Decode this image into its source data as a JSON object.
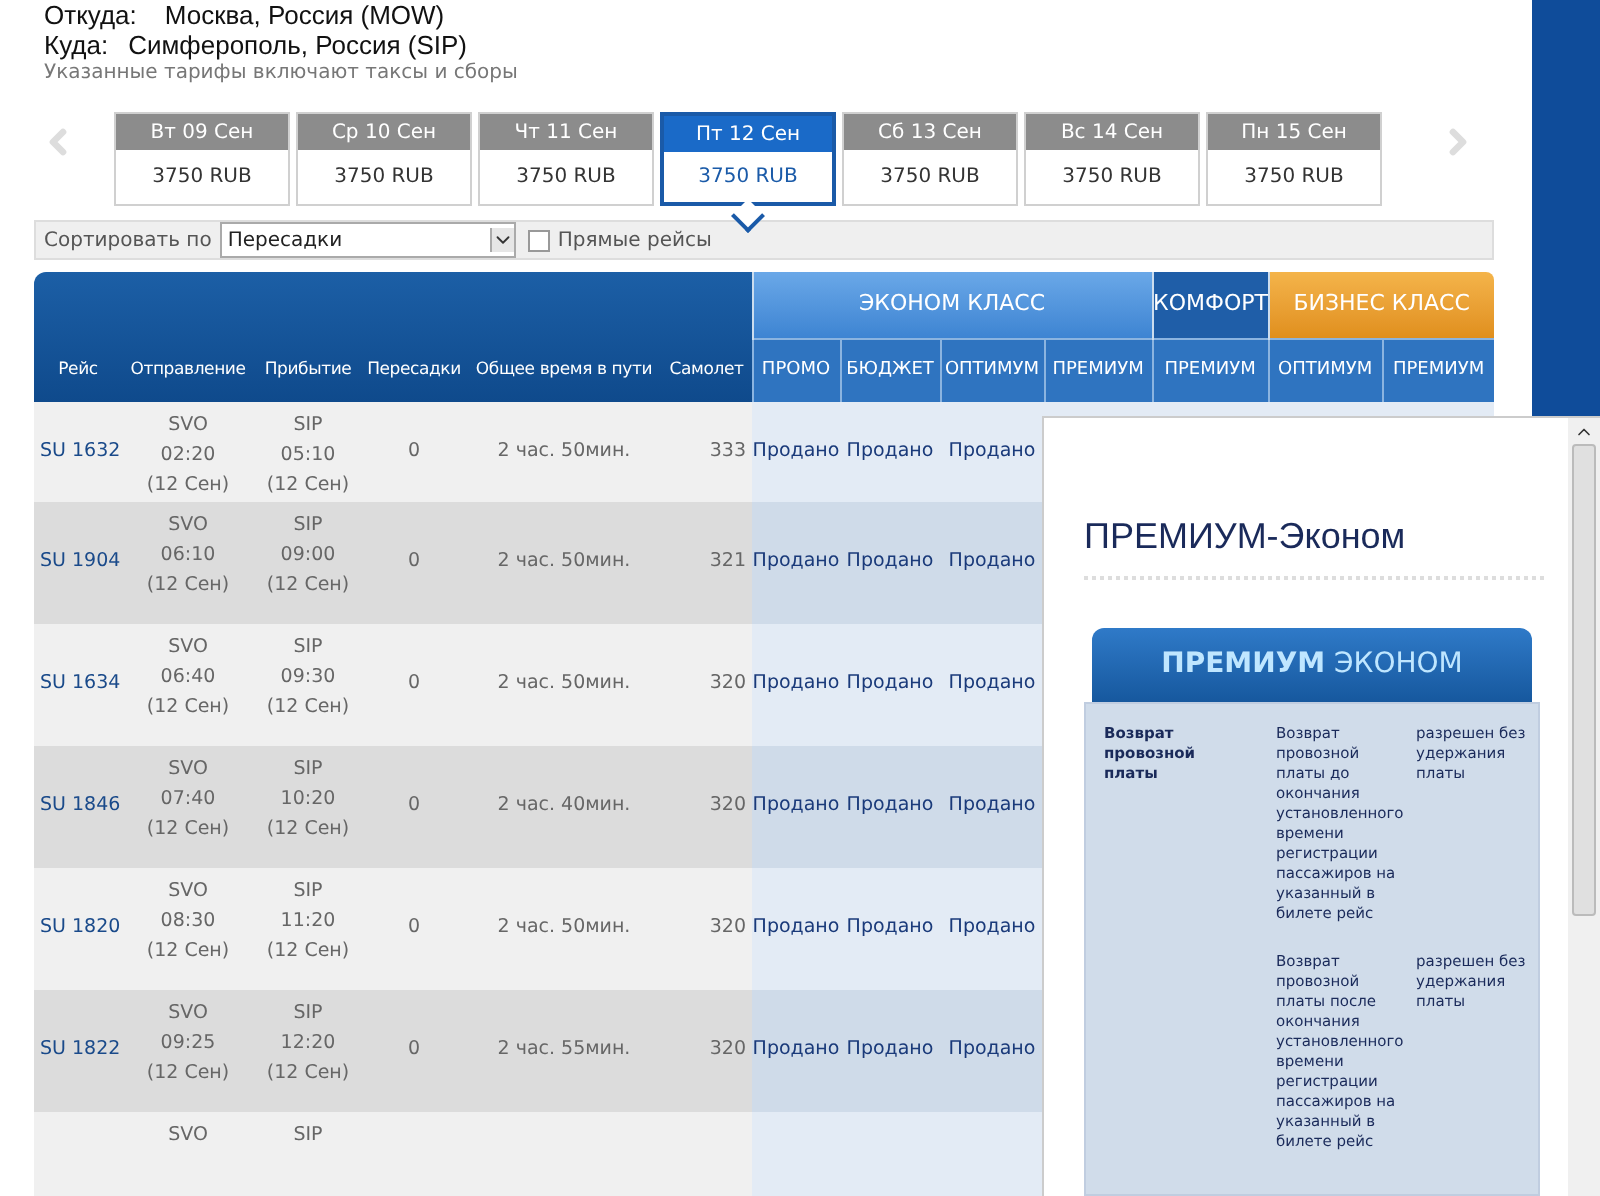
{
  "route": {
    "from_label": "Откуда:",
    "from_value": "Москва, Россия (MOW)",
    "to_label": "Куда:",
    "to_value": "Симферополь, Россия (SIP)",
    "note": "Указанные тарифы включают таксы и сборы"
  },
  "dates": [
    {
      "day": "Вт 09 Сен",
      "price": "3750 RUB",
      "selected": false
    },
    {
      "day": "Ср 10 Сен",
      "price": "3750 RUB",
      "selected": false
    },
    {
      "day": "Чт 11 Сен",
      "price": "3750 RUB",
      "selected": false
    },
    {
      "day": "Пт 12 Сен",
      "price": "3750 RUB",
      "selected": true
    },
    {
      "day": "Сб 13 Сен",
      "price": "3750 RUB",
      "selected": false
    },
    {
      "day": "Вс 14 Сен",
      "price": "3750 RUB",
      "selected": false
    },
    {
      "day": "Пн 15 Сен",
      "price": "3750 RUB",
      "selected": false
    }
  ],
  "sort": {
    "label": "Сортировать по",
    "value": "Пересадки",
    "direct": {
      "label": "Прямые рейсы",
      "checked": false
    }
  },
  "table": {
    "columns": [
      "Рейс",
      "Отправление",
      "Прибытие",
      "Пересадки",
      "Общее время в пути",
      "Самолет"
    ],
    "groups": [
      {
        "label": "ЭКОНОМ КЛАСС",
        "kind": "econom",
        "columns": [
          "ПРОМО",
          "БЮДЖЕТ",
          "ОПТИМУМ",
          "ПРЕМИУМ"
        ]
      },
      {
        "label": "КОМФОРТ",
        "kind": "comfort",
        "columns": [
          "ПРЕМИУМ"
        ]
      },
      {
        "label": "БИЗНЕС КЛАСС",
        "kind": "business",
        "columns": [
          "ОПТИМУМ",
          "ПРЕМИУМ"
        ]
      }
    ],
    "rows": [
      {
        "flight": "SU 1632",
        "departure": [
          "SVO",
          "02:20",
          "(12 Сен)"
        ],
        "arrival": [
          "SIP",
          "05:10",
          "(12 Сен)"
        ],
        "stops": "0",
        "duration": "2 час. 50мин.",
        "aircraft": "333",
        "fares": [
          "Продано",
          "Продано",
          "Продано"
        ]
      },
      {
        "flight": "SU 1904",
        "departure": [
          "SVO",
          "06:10",
          "(12 Сен)"
        ],
        "arrival": [
          "SIP",
          "09:00",
          "(12 Сен)"
        ],
        "stops": "0",
        "duration": "2 час. 50мин.",
        "aircraft": "321",
        "fares": [
          "Продано",
          "Продано",
          "Продано"
        ]
      },
      {
        "flight": "SU 1634",
        "departure": [
          "SVO",
          "06:40",
          "(12 Сен)"
        ],
        "arrival": [
          "SIP",
          "09:30",
          "(12 Сен)"
        ],
        "stops": "0",
        "duration": "2 час. 50мин.",
        "aircraft": "320",
        "fares": [
          "Продано",
          "Продано",
          "Продано"
        ]
      },
      {
        "flight": "SU 1846",
        "departure": [
          "SVO",
          "07:40",
          "(12 Сен)"
        ],
        "arrival": [
          "SIP",
          "10:20",
          "(12 Сен)"
        ],
        "stops": "0",
        "duration": "2 час. 40мин.",
        "aircraft": "320",
        "fares": [
          "Продано",
          "Продано",
          "Продано"
        ]
      },
      {
        "flight": "SU 1820",
        "departure": [
          "SVO",
          "08:30",
          "(12 Сен)"
        ],
        "arrival": [
          "SIP",
          "11:20",
          "(12 Сен)"
        ],
        "stops": "0",
        "duration": "2 час. 50мин.",
        "aircraft": "320",
        "fares": [
          "Продано",
          "Продано",
          "Продано"
        ]
      },
      {
        "flight": "SU 1822",
        "departure": [
          "SVO",
          "09:25",
          "(12 Сен)"
        ],
        "arrival": [
          "SIP",
          "12:20",
          "(12 Сен)"
        ],
        "stops": "0",
        "duration": "2 час. 55мин.",
        "aircraft": "320",
        "fares": [
          "Продано",
          "Продано",
          "Продано"
        ]
      },
      {
        "departure": [
          "SVO"
        ],
        "arrival": [
          "SIP"
        ]
      }
    ]
  },
  "popup": {
    "title": "ПРЕМИУМ-Эконом",
    "card_title": "**ПРЕМИУМ** ЭКОНОМ",
    "rules": [
      {
        "label": "Возврат провозной платы",
        "items": [
          {
            "condition": "Возврат провозной платы до окончания установленного времени регистрации пассажиров на указанный в билете рейс",
            "value": "разрешен без удержания платы"
          },
          {
            "condition": "Возврат провозной платы после окончания установленного времени регистрации пассажиров на указанный в билете рейс",
            "value": "разрешен без удержания платы"
          }
        ]
      }
    ]
  }
}
